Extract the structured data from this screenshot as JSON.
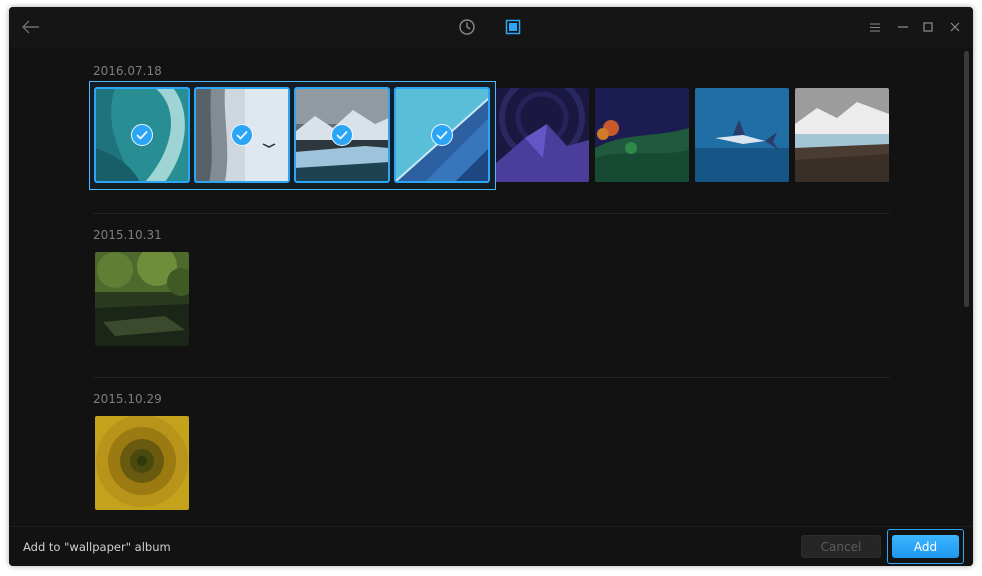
{
  "titlebar": {
    "icons": {
      "back": "arrow-left-icon",
      "timeline": "clock-icon",
      "albums": "album-icon",
      "menu": "menu-icon",
      "minimize": "minimize-icon",
      "maximize": "maximize-icon",
      "close": "close-icon"
    },
    "active_view": "albums",
    "accent_color": "#2ca7f8"
  },
  "groups": [
    {
      "date": "2016.07.18",
      "photos": [
        {
          "subject": "teal abstract sculpture",
          "selected": true
        },
        {
          "subject": "misty cliff with bird",
          "selected": true
        },
        {
          "subject": "glacier and mountains",
          "selected": true
        },
        {
          "subject": "blue building facade",
          "selected": true
        },
        {
          "subject": "purple low-poly mountain",
          "selected": false
        },
        {
          "subject": "dark landscape with trees",
          "selected": false
        },
        {
          "subject": "swordfish underwater",
          "selected": false
        },
        {
          "subject": "glacier with snowy mountains",
          "selected": false
        }
      ]
    },
    {
      "date": "2015.10.31",
      "photos": [
        {
          "subject": "green forest pond",
          "selected": false
        }
      ]
    },
    {
      "date": "2015.10.29",
      "photos": [
        {
          "subject": "yellow flower close-up",
          "selected": false
        }
      ]
    }
  ],
  "footer": {
    "hint": "Add to \"wallpaper\" album",
    "cancel_label": "Cancel",
    "add_label": "Add"
  }
}
